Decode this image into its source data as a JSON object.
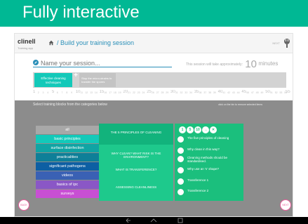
{
  "banner": {
    "title": "Fully interactive"
  },
  "app": {
    "logo": "clinell",
    "logo_sub": "Training app",
    "breadcrumb": "/ Build your training session",
    "next_small": "NEXT",
    "session": {
      "placeholder": "Name your session..."
    },
    "duration": {
      "prefix": "This session will take approximately:",
      "value": "10",
      "unit": "minutes"
    },
    "timeline": {
      "blocks": [
        {
          "label": "Effective cleaning techniques",
          "color": "#13c9b9"
        },
        {
          "label": "Stop the micro-strains to transfer the spores",
          "color": "#c4c4c4"
        }
      ],
      "ruler": [
        "1",
        "2",
        "3",
        "4",
        "5",
        "6",
        "7",
        "8",
        "9",
        "10",
        "11",
        "12",
        "13",
        "14",
        "15",
        "16",
        "17",
        "18",
        "19",
        "20",
        "21",
        "22",
        "23",
        "24",
        "25",
        "26",
        "27",
        "28",
        "29",
        "30",
        "31",
        "32",
        "33",
        "34",
        "35",
        "36",
        "37",
        "38",
        "39",
        "40",
        "41",
        "42",
        "43",
        "44",
        "45",
        "46",
        "47",
        "48",
        "49",
        "50",
        "51",
        "52",
        "53",
        "54",
        "55"
      ]
    },
    "panel": {
      "heading": "Select training blocks from the categories below",
      "note": "click on the bin to remove selected items"
    },
    "categories": [
      {
        "label": "all",
        "color": "#a8a8a8"
      },
      {
        "label": "basic principles",
        "color": "#13c9b9"
      },
      {
        "label": "surface disinfection",
        "color": "#10a4a4"
      },
      {
        "label": "practicalities",
        "color": "#0e7f98"
      },
      {
        "label": "significant pathogens",
        "color": "#0d5fa3"
      },
      {
        "label": "videos",
        "color": "#3a61b4"
      },
      {
        "label": "basics of ipc",
        "color": "#8a57c6"
      },
      {
        "label": "surveys",
        "color": "#c84fd3"
      }
    ],
    "blocks": [
      "THE 5 PRINCIPLES OF CLEANING",
      "WHY CLEAN? WHAT RISK IS THE ENVIRONMENT?",
      "WHAT IS TRANSFERENCE?",
      "ASSESSING CLEANLINESS"
    ],
    "topic_icons": [
      "1",
      "5",
      "10",
      "→",
      "✕"
    ],
    "topics": [
      "The five principles of cleaning",
      "Why clean in this way?",
      "Cleaning methods should be standardised.",
      "Why use an 's' shape?",
      "Transference 1",
      "Transference 2"
    ],
    "back_label": "BACK",
    "next_label": "NEXT"
  }
}
